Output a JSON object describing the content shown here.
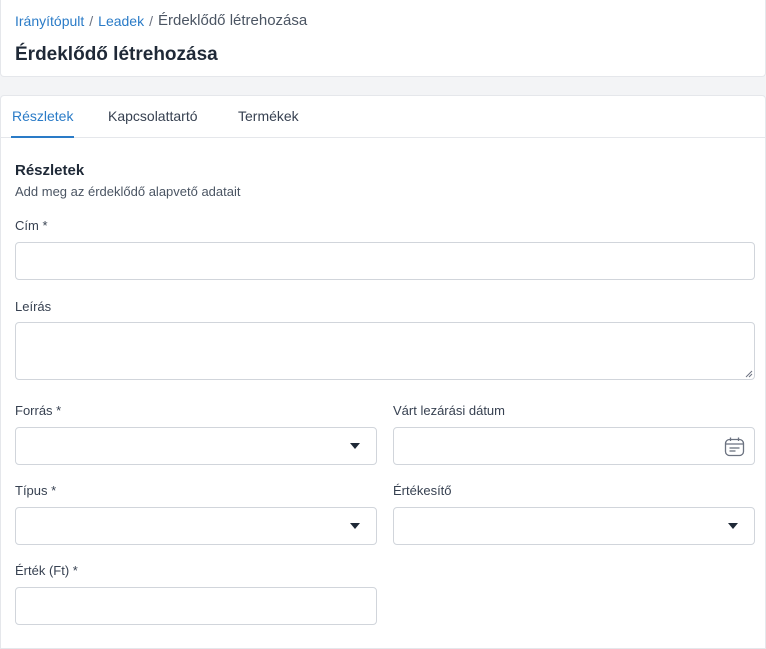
{
  "breadcrumb": {
    "items": [
      "Irányítópult",
      "Leadek"
    ],
    "separator": "/",
    "current": "Érdeklődő létrehozása"
  },
  "page_title": "Érdeklődő létrehozása",
  "tabs": [
    {
      "label": "Részletek",
      "active": true
    },
    {
      "label": "Kapcsolattartó",
      "active": false
    },
    {
      "label": "Termékek",
      "active": false
    }
  ],
  "section": {
    "title": "Részletek",
    "subtitle": "Add meg az érdeklődő alapvető adatait"
  },
  "fields": {
    "cim": {
      "label": "Cím *",
      "value": ""
    },
    "leiras": {
      "label": "Leírás",
      "value": ""
    },
    "forras": {
      "label": "Forrás *",
      "value": ""
    },
    "lezaras": {
      "label": "Várt lezárási dátum",
      "value": ""
    },
    "tipus": {
      "label": "Típus *",
      "value": ""
    },
    "ertekesito": {
      "label": "Értékesítő",
      "value": ""
    },
    "ertek": {
      "label": "Érték (Ft) *",
      "value": ""
    }
  },
  "colors": {
    "accent": "#2a7bc7",
    "background": "#f3f4f6",
    "border": "#d1d5db"
  },
  "icons": {
    "select": "chevron-down-icon",
    "date": "calendar-icon",
    "textarea": "resize-handle-icon"
  }
}
